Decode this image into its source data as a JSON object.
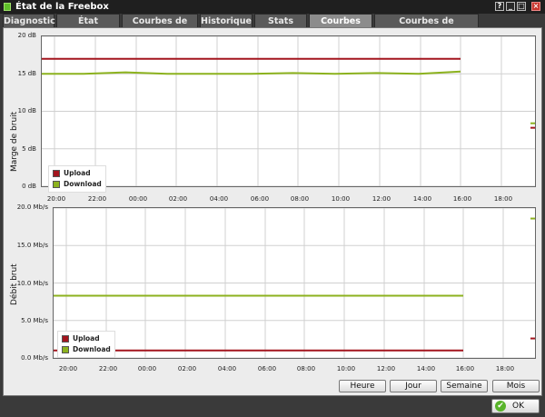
{
  "window": {
    "title": "État de la Freebox",
    "controls": [
      "?",
      "_",
      "□",
      "×"
    ]
  },
  "tabs": [
    {
      "label": "Diagnostic"
    },
    {
      "label": "État Internet"
    },
    {
      "label": "Courbes de Débit"
    },
    {
      "label": "Historique"
    },
    {
      "label": "Stats xDSL"
    },
    {
      "label": "Courbes xDSL"
    },
    {
      "label": "Courbes de température"
    }
  ],
  "active_tab": "Courbes xDSL",
  "colors": {
    "upload": "#a3151e",
    "download": "#8cb21e"
  },
  "range_buttons": {
    "hour": "Heure",
    "day": "Jour",
    "week": "Semaine",
    "month": "Mois"
  },
  "ok_label": "OK",
  "chart_data": [
    {
      "type": "line",
      "ylabel": "Marge de bruit",
      "y_ticks": [
        "20 dB",
        "15 dB",
        "10 dB",
        "5 dB",
        "0 dB"
      ],
      "ylim": [
        0,
        20
      ],
      "x_ticks": [
        "20:00",
        "22:00",
        "00:00",
        "02:00",
        "04:00",
        "06:00",
        "08:00",
        "10:00",
        "12:00",
        "14:00",
        "16:00",
        "18:00"
      ],
      "legend": [
        "Upload",
        "Download"
      ],
      "grid": true,
      "series": [
        {
          "name": "Upload",
          "color": "#a3151e",
          "values": [
            17,
            17,
            17,
            17,
            17,
            17,
            17,
            17,
            17,
            17,
            17
          ],
          "current": 7.8
        },
        {
          "name": "Download",
          "color": "#8cb21e",
          "values": [
            15,
            15,
            15.2,
            15,
            15,
            15,
            15.1,
            15,
            15.1,
            15,
            15.3
          ],
          "current": 8.4
        }
      ]
    },
    {
      "type": "line",
      "ylabel": "Débit brut",
      "y_ticks": [
        "20.0 Mb/s",
        "15.0 Mb/s",
        "10.0 Mb/s",
        "5.0 Mb/s",
        "0.0 Mb/s"
      ],
      "ylim": [
        0,
        20
      ],
      "x_ticks": [
        "20:00",
        "22:00",
        "00:00",
        "02:00",
        "04:00",
        "06:00",
        "08:00",
        "10:00",
        "12:00",
        "14:00",
        "16:00",
        "18:00"
      ],
      "legend": [
        "Upload",
        "Download"
      ],
      "grid": true,
      "series": [
        {
          "name": "Upload",
          "color": "#a3151e",
          "values": [
            1,
            1,
            1,
            1,
            1,
            1,
            1,
            1,
            1,
            1,
            1
          ],
          "current": 2.6
        },
        {
          "name": "Download",
          "color": "#8cb21e",
          "values": [
            8.3,
            8.3,
            8.3,
            8.3,
            8.3,
            8.3,
            8.3,
            8.3,
            8.3,
            8.3,
            8.3
          ],
          "current": 18.6
        }
      ]
    }
  ]
}
